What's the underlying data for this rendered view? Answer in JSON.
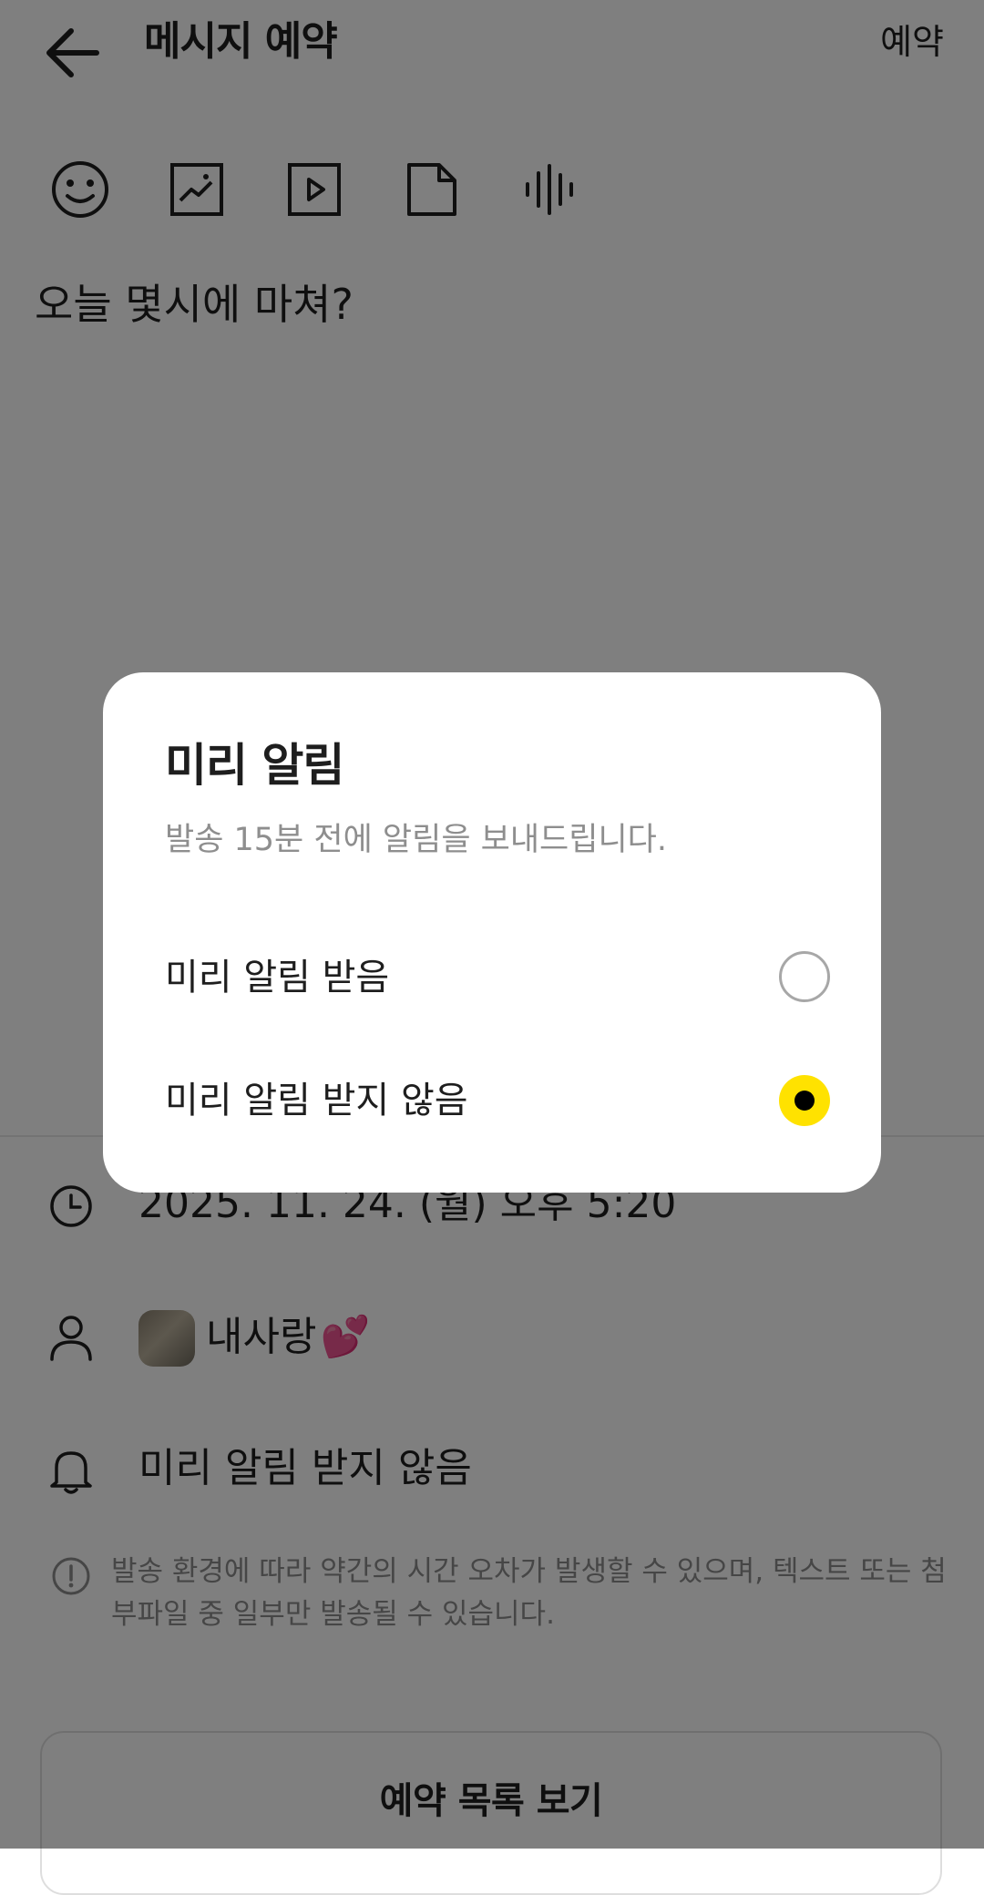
{
  "header": {
    "title": "메시지 예약",
    "reserve_label": "예약"
  },
  "toolbar": {
    "icons": [
      "emoticon-icon",
      "image-icon",
      "video-icon",
      "file-icon",
      "voice-icon"
    ]
  },
  "message": {
    "text": "오늘 몇시에 마쳐?"
  },
  "schedule": {
    "datetime": "2025. 11. 24. (월) 오후 5:20",
    "receiver": "내사랑",
    "receiver_emoji": "💕",
    "reminder_value": "미리 알림 받지 않음",
    "notice": "발송 환경에 따라 약간의 시간 오차가 발생할 수 있으며, 텍스트 또는 첨부파일 중 일부만 발송될 수 있습니다."
  },
  "footer": {
    "list_button": "예약 목록 보기"
  },
  "dialog": {
    "title": "미리 알림",
    "description": "발송 15분 전에 알림을 보내드립니다.",
    "options": [
      {
        "label": "미리 알림 받음",
        "selected": false
      },
      {
        "label": "미리 알림 받지 않음",
        "selected": true
      }
    ],
    "accent_color": "#FFE200"
  },
  "colors": {
    "scrim": "#000000",
    "text": "#1E1E1E",
    "subtext": "#8E8E8E"
  }
}
